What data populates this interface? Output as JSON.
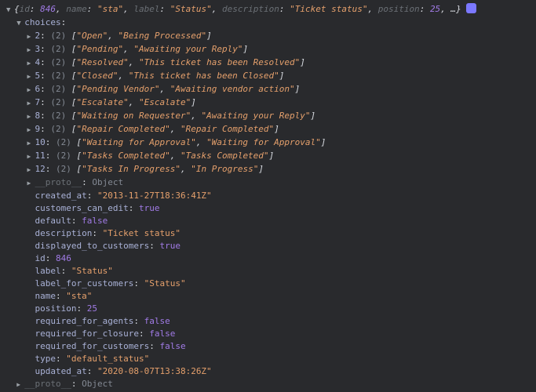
{
  "summary": {
    "id": 846,
    "name": "sta",
    "label": "Status",
    "description": "Ticket status",
    "position": 25
  },
  "choices_key": "choices",
  "choices": [
    {
      "idx": "2",
      "len": 2,
      "a": "Open",
      "b": "Being Processed"
    },
    {
      "idx": "3",
      "len": 2,
      "a": "Pending",
      "b": "Awaiting your Reply"
    },
    {
      "idx": "4",
      "len": 2,
      "a": "Resolved",
      "b": "This ticket has been Resolved"
    },
    {
      "idx": "5",
      "len": 2,
      "a": "Closed",
      "b": "This ticket has been Closed"
    },
    {
      "idx": "6",
      "len": 2,
      "a": "Pending Vendor",
      "b": "Awaiting vendor action"
    },
    {
      "idx": "7",
      "len": 2,
      "a": "Escalate",
      "b": "Escalate"
    },
    {
      "idx": "8",
      "len": 2,
      "a": "Waiting on Requester",
      "b": "Awaiting your Reply"
    },
    {
      "idx": "9",
      "len": 2,
      "a": "Repair Completed",
      "b": "Repair Completed"
    },
    {
      "idx": "10",
      "len": 2,
      "a": "Waiting for Approval",
      "b": "Waiting for Approval"
    },
    {
      "idx": "11",
      "len": 2,
      "a": "Tasks Completed",
      "b": "Tasks Completed"
    },
    {
      "idx": "12",
      "len": 2,
      "a": "Tasks In Progress",
      "b": "In Progress"
    }
  ],
  "proto_key": "__proto__",
  "proto_val": "Object",
  "props": [
    {
      "k": "created_at",
      "v": "2013-11-27T18:36:41Z",
      "t": "str"
    },
    {
      "k": "customers_can_edit",
      "v": "true",
      "t": "num"
    },
    {
      "k": "default",
      "v": "false",
      "t": "num"
    },
    {
      "k": "description",
      "v": "Ticket status",
      "t": "str"
    },
    {
      "k": "displayed_to_customers",
      "v": "true",
      "t": "num"
    },
    {
      "k": "id",
      "v": "846",
      "t": "num"
    },
    {
      "k": "label",
      "v": "Status",
      "t": "str"
    },
    {
      "k": "label_for_customers",
      "v": "Status",
      "t": "str"
    },
    {
      "k": "name",
      "v": "sta",
      "t": "str"
    },
    {
      "k": "position",
      "v": "25",
      "t": "num"
    },
    {
      "k": "required_for_agents",
      "v": "false",
      "t": "num"
    },
    {
      "k": "required_for_closure",
      "v": "false",
      "t": "num"
    },
    {
      "k": "required_for_customers",
      "v": "false",
      "t": "num"
    },
    {
      "k": "type",
      "v": "default_status",
      "t": "str"
    },
    {
      "k": "updated_at",
      "v": "2020-08-07T13:38:26Z",
      "t": "str"
    }
  ]
}
